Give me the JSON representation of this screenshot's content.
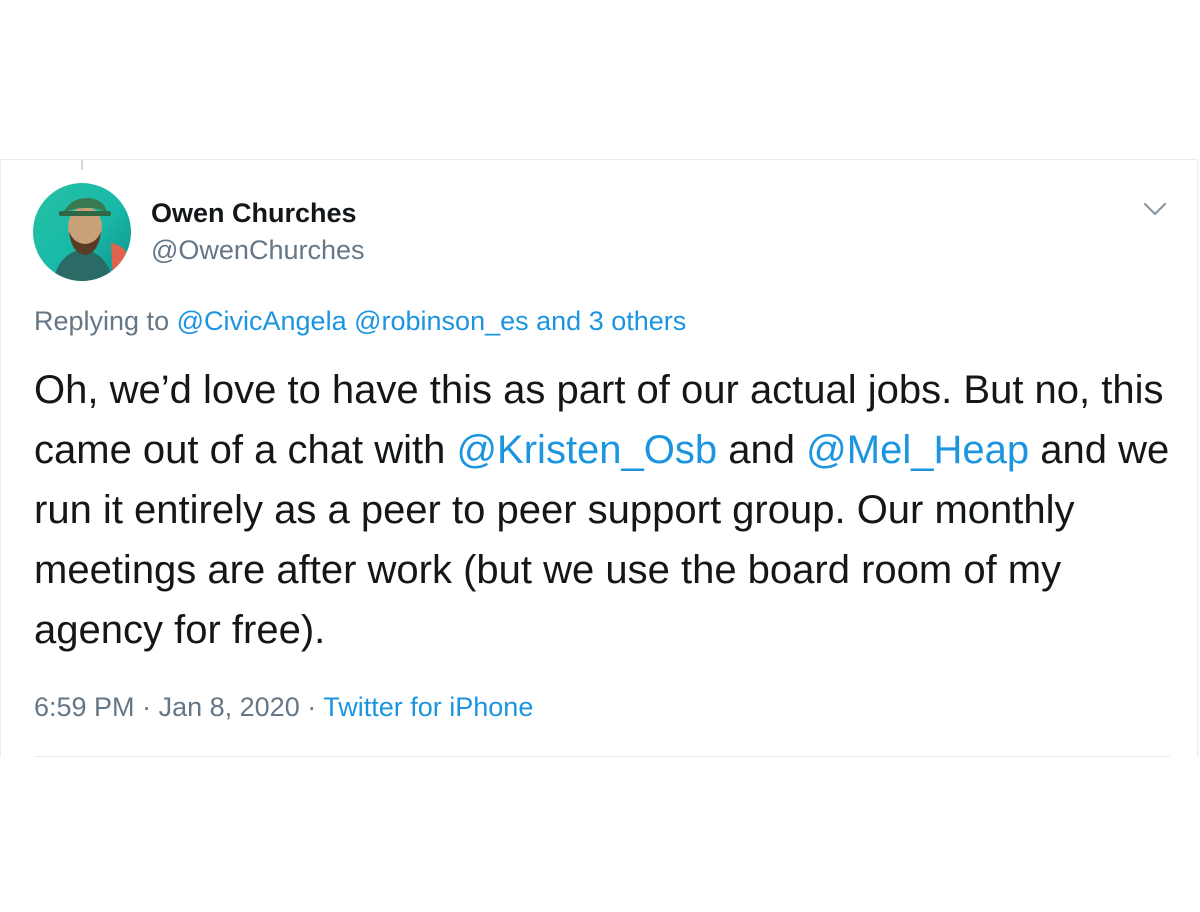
{
  "tweet": {
    "author_name": "Owen Churches",
    "author_handle": "@OwenChurches",
    "replying_to": {
      "prefix": "Replying to",
      "mention_1": "@CivicAngela",
      "mention_2": "@robinson_es",
      "others": "and 3 others"
    },
    "body": {
      "part_1": "Oh, we’d love to have this as part of our actual jobs. But no, this came out of a chat with",
      "mention_1": "@Kristen_Osb",
      "part_2": "and",
      "mention_2": "@Mel_Heap",
      "part_3": "and we run it entirely as a peer to peer support group. Our monthly meetings are after work (but we use the board room of my agency for free)."
    },
    "meta": {
      "time": "6:59 PM",
      "separator_1": "·",
      "date": "Jan 8, 2020",
      "separator_2": "·",
      "source": "Twitter for iPhone"
    },
    "icons": {
      "avatar": "avatar-photo",
      "menu": "chevron-down-icon"
    },
    "colors": {
      "link": "#1b95e0",
      "text": "#14171a",
      "secondary": "#657786",
      "border": "#e6ecf0"
    }
  }
}
